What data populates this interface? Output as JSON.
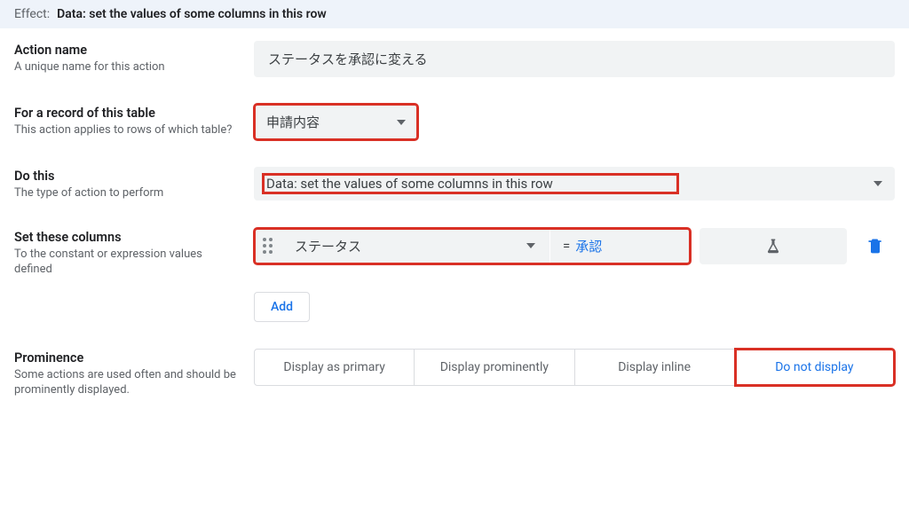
{
  "header": {
    "effect_label": "Effect:",
    "effect_value": "Data: set the values of some columns in this row"
  },
  "fields": {
    "action_name": {
      "title": "Action name",
      "sub": "A unique name for this action",
      "value": "ステータスを承認に変える"
    },
    "for_table": {
      "title": "For a record of this table",
      "sub": "This action applies to rows of which table?",
      "value": "申請内容"
    },
    "do_this": {
      "title": "Do this",
      "sub": "The type of action to perform",
      "value": "Data: set the values of some columns in this row"
    },
    "set_columns": {
      "title": "Set these columns",
      "sub": "To the constant or expression values defined",
      "rows": [
        {
          "column": "ステータス",
          "equals": "=",
          "value": "承認"
        }
      ],
      "add_label": "Add"
    },
    "prominence": {
      "title": "Prominence",
      "sub": "Some actions are used often and should be prominently displayed.",
      "options": [
        "Display as primary",
        "Display prominently",
        "Display inline",
        "Do not display"
      ],
      "selected_index": 3
    }
  }
}
